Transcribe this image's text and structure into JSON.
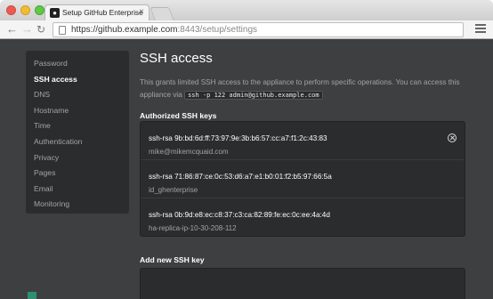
{
  "browser": {
    "tab_title": "Setup GitHub Enterprise",
    "tab_close": "×",
    "url_host_prefix": "https://",
    "url_host": "github.example.com",
    "url_path": ":8443/setup/settings"
  },
  "sidebar": {
    "items": [
      {
        "label": "Password",
        "active": false
      },
      {
        "label": "SSH access",
        "active": true
      },
      {
        "label": "DNS",
        "active": false
      },
      {
        "label": "Hostname",
        "active": false
      },
      {
        "label": "Time",
        "active": false
      },
      {
        "label": "Authentication",
        "active": false
      },
      {
        "label": "Privacy",
        "active": false
      },
      {
        "label": "Pages",
        "active": false
      },
      {
        "label": "Email",
        "active": false
      },
      {
        "label": "Monitoring",
        "active": false
      }
    ]
  },
  "main": {
    "title": "SSH access",
    "description_pre": "This grants limited SSH access to the appliance to perform specific operations. You can access this appliance via",
    "command": "ssh -p 122 admin@github.example.com",
    "authorized_title": "Authorized SSH keys",
    "keys": [
      {
        "fingerprint": "ssh-rsa 9b:bd:6d:ff:73:97:9e:3b:b6:57:cc:a7:f1:2c:43:83",
        "label": "mike@mikemcquaid.com"
      },
      {
        "fingerprint": "ssh-rsa 71:86:87:ce:0c:53:d6:a7:e1:b0:01:f2:b5:97:66:5a",
        "label": "id_ghenterprise"
      },
      {
        "fingerprint": "ssh-rsa 0b:9d:e8:ec:c8:37:c3:ca:82:89:fe:ec:0c:ee:4a:4d",
        "label": "ha-replica-ip-10-30-208-112"
      }
    ],
    "add_title": "Add new SSH key"
  },
  "colors": {
    "page_bg": "#3e3f40",
    "panel_bg": "#2b2c2d",
    "text_primary": "#ffffff",
    "text_muted": "#a3a4a5"
  },
  "icons": [
    "close-window-light",
    "minimize-light",
    "zoom-light",
    "favicon-icon",
    "back-arrow-icon",
    "forward-arrow-icon",
    "reload-icon",
    "page-icon",
    "menu-icon",
    "remove-key-icon"
  ]
}
